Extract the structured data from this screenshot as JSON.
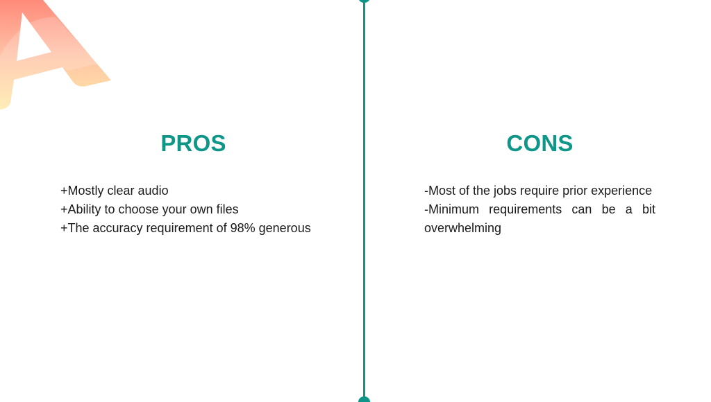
{
  "brand": {
    "accent_color": "#0e9688",
    "logo_icon": "letter-a-logo"
  },
  "pros": {
    "heading": "PROS",
    "items": [
      "+Mostly clear audio",
      "+Ability to choose your own files",
      "+The accuracy requirement of 98% generous"
    ]
  },
  "cons": {
    "heading": "CONS",
    "items": [
      "-Most of the jobs require prior experience",
      "-Minimum requirements can be a bit overwhelming"
    ]
  }
}
